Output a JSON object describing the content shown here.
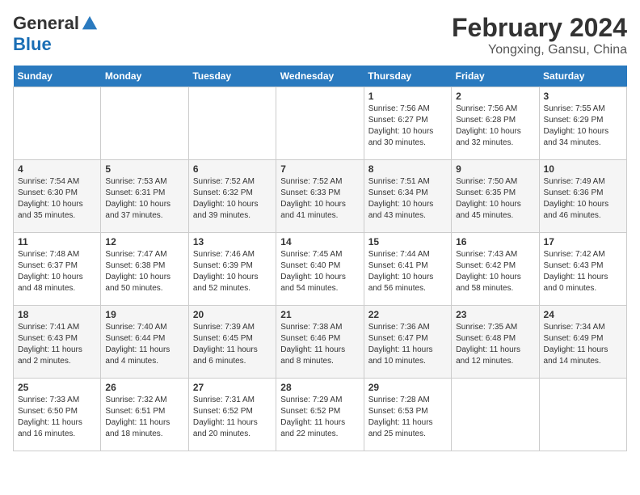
{
  "logo": {
    "general": "General",
    "blue": "Blue"
  },
  "title": "February 2024",
  "subtitle": "Yongxing, Gansu, China",
  "days_of_week": [
    "Sunday",
    "Monday",
    "Tuesday",
    "Wednesday",
    "Thursday",
    "Friday",
    "Saturday"
  ],
  "weeks": [
    [
      {
        "day": "",
        "info": ""
      },
      {
        "day": "",
        "info": ""
      },
      {
        "day": "",
        "info": ""
      },
      {
        "day": "",
        "info": ""
      },
      {
        "day": "1",
        "info": "Sunrise: 7:56 AM\nSunset: 6:27 PM\nDaylight: 10 hours and 30 minutes."
      },
      {
        "day": "2",
        "info": "Sunrise: 7:56 AM\nSunset: 6:28 PM\nDaylight: 10 hours and 32 minutes."
      },
      {
        "day": "3",
        "info": "Sunrise: 7:55 AM\nSunset: 6:29 PM\nDaylight: 10 hours and 34 minutes."
      }
    ],
    [
      {
        "day": "4",
        "info": "Sunrise: 7:54 AM\nSunset: 6:30 PM\nDaylight: 10 hours and 35 minutes."
      },
      {
        "day": "5",
        "info": "Sunrise: 7:53 AM\nSunset: 6:31 PM\nDaylight: 10 hours and 37 minutes."
      },
      {
        "day": "6",
        "info": "Sunrise: 7:52 AM\nSunset: 6:32 PM\nDaylight: 10 hours and 39 minutes."
      },
      {
        "day": "7",
        "info": "Sunrise: 7:52 AM\nSunset: 6:33 PM\nDaylight: 10 hours and 41 minutes."
      },
      {
        "day": "8",
        "info": "Sunrise: 7:51 AM\nSunset: 6:34 PM\nDaylight: 10 hours and 43 minutes."
      },
      {
        "day": "9",
        "info": "Sunrise: 7:50 AM\nSunset: 6:35 PM\nDaylight: 10 hours and 45 minutes."
      },
      {
        "day": "10",
        "info": "Sunrise: 7:49 AM\nSunset: 6:36 PM\nDaylight: 10 hours and 46 minutes."
      }
    ],
    [
      {
        "day": "11",
        "info": "Sunrise: 7:48 AM\nSunset: 6:37 PM\nDaylight: 10 hours and 48 minutes."
      },
      {
        "day": "12",
        "info": "Sunrise: 7:47 AM\nSunset: 6:38 PM\nDaylight: 10 hours and 50 minutes."
      },
      {
        "day": "13",
        "info": "Sunrise: 7:46 AM\nSunset: 6:39 PM\nDaylight: 10 hours and 52 minutes."
      },
      {
        "day": "14",
        "info": "Sunrise: 7:45 AM\nSunset: 6:40 PM\nDaylight: 10 hours and 54 minutes."
      },
      {
        "day": "15",
        "info": "Sunrise: 7:44 AM\nSunset: 6:41 PM\nDaylight: 10 hours and 56 minutes."
      },
      {
        "day": "16",
        "info": "Sunrise: 7:43 AM\nSunset: 6:42 PM\nDaylight: 10 hours and 58 minutes."
      },
      {
        "day": "17",
        "info": "Sunrise: 7:42 AM\nSunset: 6:43 PM\nDaylight: 11 hours and 0 minutes."
      }
    ],
    [
      {
        "day": "18",
        "info": "Sunrise: 7:41 AM\nSunset: 6:43 PM\nDaylight: 11 hours and 2 minutes."
      },
      {
        "day": "19",
        "info": "Sunrise: 7:40 AM\nSunset: 6:44 PM\nDaylight: 11 hours and 4 minutes."
      },
      {
        "day": "20",
        "info": "Sunrise: 7:39 AM\nSunset: 6:45 PM\nDaylight: 11 hours and 6 minutes."
      },
      {
        "day": "21",
        "info": "Sunrise: 7:38 AM\nSunset: 6:46 PM\nDaylight: 11 hours and 8 minutes."
      },
      {
        "day": "22",
        "info": "Sunrise: 7:36 AM\nSunset: 6:47 PM\nDaylight: 11 hours and 10 minutes."
      },
      {
        "day": "23",
        "info": "Sunrise: 7:35 AM\nSunset: 6:48 PM\nDaylight: 11 hours and 12 minutes."
      },
      {
        "day": "24",
        "info": "Sunrise: 7:34 AM\nSunset: 6:49 PM\nDaylight: 11 hours and 14 minutes."
      }
    ],
    [
      {
        "day": "25",
        "info": "Sunrise: 7:33 AM\nSunset: 6:50 PM\nDaylight: 11 hours and 16 minutes."
      },
      {
        "day": "26",
        "info": "Sunrise: 7:32 AM\nSunset: 6:51 PM\nDaylight: 11 hours and 18 minutes."
      },
      {
        "day": "27",
        "info": "Sunrise: 7:31 AM\nSunset: 6:52 PM\nDaylight: 11 hours and 20 minutes."
      },
      {
        "day": "28",
        "info": "Sunrise: 7:29 AM\nSunset: 6:52 PM\nDaylight: 11 hours and 22 minutes."
      },
      {
        "day": "29",
        "info": "Sunrise: 7:28 AM\nSunset: 6:53 PM\nDaylight: 11 hours and 25 minutes."
      },
      {
        "day": "",
        "info": ""
      },
      {
        "day": "",
        "info": ""
      }
    ]
  ]
}
